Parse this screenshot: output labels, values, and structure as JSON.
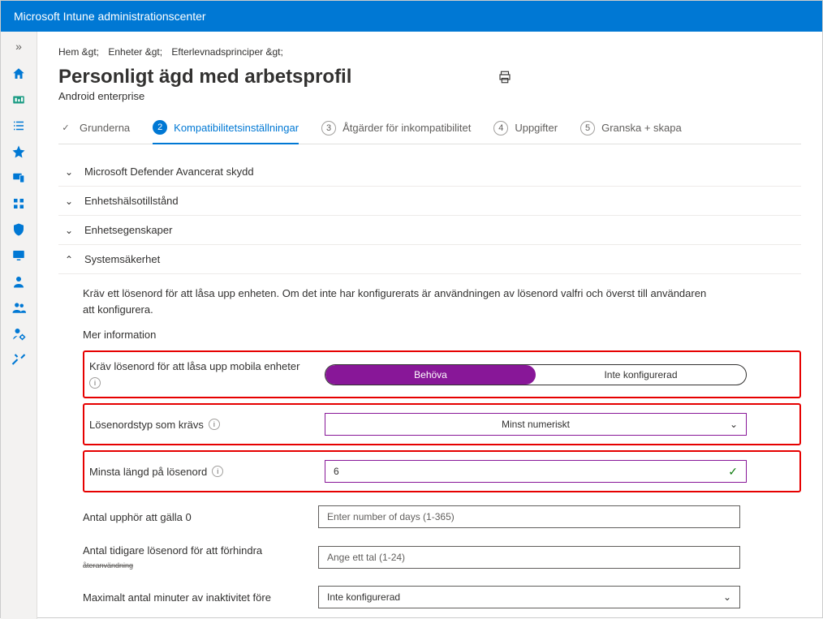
{
  "header": {
    "title": "Microsoft Intune administrationscenter"
  },
  "breadcrumb": [
    "Hem &gt;",
    "Enheter &gt;",
    "Efterlevnadsprinciper &gt;"
  ],
  "page": {
    "title": "Personligt ägd med arbetsprofil",
    "subtitle": "Android enterprise"
  },
  "steps": [
    {
      "num": "✓",
      "label": "Grunderna",
      "state": "done"
    },
    {
      "num": "2",
      "label": "Kompatibilitetsinställningar",
      "state": "active"
    },
    {
      "num": "3",
      "label": "Åtgärder för inkompatibilitet",
      "state": ""
    },
    {
      "num": "4",
      "label": "Uppgifter",
      "state": ""
    },
    {
      "num": "5",
      "label": "Granska + skapa",
      "state": ""
    }
  ],
  "sections": {
    "collapsed": [
      "Microsoft Defender Avancerat skydd",
      "Enhetshälsotillstånd",
      "Enhetsegenskaper"
    ],
    "expanded_title": "Systemsäkerhet",
    "description": "Kräv ett lösenord för att låsa upp enheten. Om det inte har konfigurerats är användningen av lösenord valfri och överst till användaren att konfigurera.",
    "more_info": "Mer information"
  },
  "fields": {
    "require_pw": {
      "label": "Kräv lösenord för att låsa upp mobila enheter",
      "opt_active": "Behöva",
      "opt_inactive": "Inte konfigurerad"
    },
    "pw_type": {
      "label": "Lösenordstyp som krävs",
      "value": "Minst numeriskt"
    },
    "min_len": {
      "label": "Minsta längd på lösenord",
      "value": "6"
    },
    "expire": {
      "label": "Antal upphör att gälla 0",
      "placeholder": "Enter number of days (1-365)"
    },
    "prev_pw": {
      "label": "Antal tidigare lösenord för att förhindra",
      "sublabel": "återanvändning",
      "placeholder": "Ange ett tal (1-24)"
    },
    "inactivity": {
      "label": "Maximalt antal minuter av inaktivitet före",
      "value": "Inte konfigurerad"
    }
  }
}
